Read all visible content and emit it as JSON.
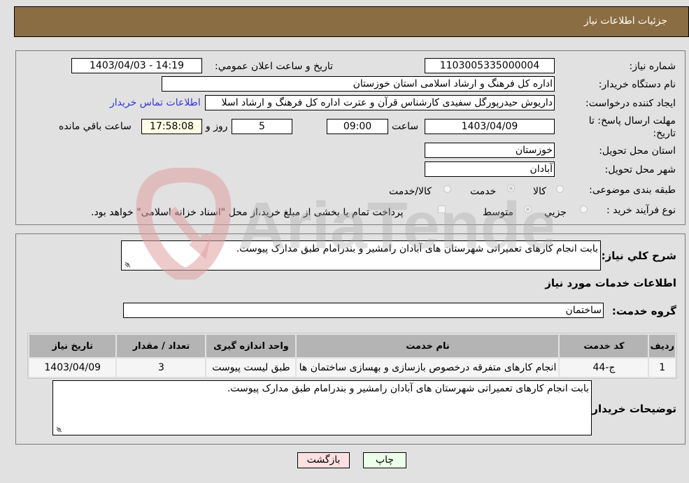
{
  "header": {
    "title": "جزئیات اطلاعات نیاز"
  },
  "fields": {
    "need_number": {
      "label": "شماره نیاز:",
      "value": "1103005335000004"
    },
    "announce_datetime": {
      "label": "تاریخ و ساعت اعلان عمومي:",
      "value": "1403/04/03 - 14:19"
    },
    "buyer_org": {
      "label": "نام دستگاه خريدار:",
      "value": "اداره کل فرهنگ و ارشاد اسلامی استان خوزستان"
    },
    "requester": {
      "label": "ایجاد کننده درخواست:",
      "value": "داریوش حیدرپورگل سفیدی کارشناس قرآن و عترت اداره کل فرهنگ و ارشاد اسلا"
    },
    "buyer_contact_link": "اطلاعات تماس خریدار",
    "deadline": {
      "label_line1": "مهلت ارسال پاسخ: تا",
      "label_line2": "تاریخ:",
      "date": "1403/04/09",
      "time_label": "ساعت",
      "time": "09:00",
      "days": "5",
      "days_label": "روز و",
      "remaining": "17:58:08",
      "remaining_label": "ساعت باقي مانده"
    },
    "province": {
      "label": "استان محل تحویل:",
      "value": "خوزستان"
    },
    "city": {
      "label": "شهر محل تحویل:",
      "value": "آبادان"
    },
    "category": {
      "label": "طبقه بندی موضوعی:",
      "options": [
        "کالا",
        "خدمت",
        "کالا/خدمت"
      ],
      "selected": "خدمت"
    },
    "purchase_process": {
      "label": "نوع فرآیند خرید :",
      "options": [
        "جزيي",
        "متوسط"
      ],
      "selected": "متوسط",
      "treasury_checkbox_label": "پرداخت تمام یا بخشی از مبلغ خرید،از محل \"اسناد خزانه اسلامی\" خواهد بود."
    }
  },
  "description": {
    "label": "شرح کلي نياز:",
    "value": "بابت انجام کارهای تعمیراتی شهرستان های آبادان رامشیر و بندرامام طبق مدارک پیوست."
  },
  "services_section": {
    "title": "اطلاعات خدمات مورد نياز",
    "group_label": "گروه خدمت:",
    "group_value": "ساختمان",
    "table": {
      "headers": [
        "ردیف",
        "کد خدمت",
        "نام خدمت",
        "واحد اندازه گیری",
        "تعداد / مقدار",
        "تاریخ نیاز"
      ],
      "rows": [
        [
          "1",
          "ج-44",
          "انجام کارهای متفرقه درخصوص بازسازی و بهسازی ساختمان ها",
          "طبق لیست پیوست",
          "3",
          "1403/04/09"
        ]
      ]
    },
    "buyer_notes_label": "توضیحات خریدار:",
    "buyer_notes": "بابت انجام کارهای تعمیراتی شهرستان های آبادان رامشیر و بندرامام طبق مدارک پیوست."
  },
  "buttons": {
    "print": "چاپ",
    "back": "بازگشت"
  },
  "colors": {
    "header_bg": "#8b6d43",
    "link": "#3535d0",
    "print_bg": "#ecffe8",
    "back_bg": "#ffe0e0"
  },
  "watermark": "AriaTender.neT"
}
